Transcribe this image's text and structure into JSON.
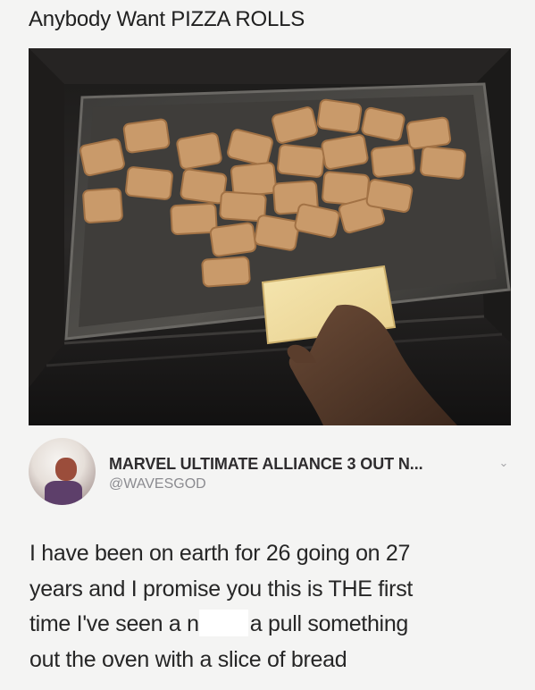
{
  "post": {
    "title": "Anybody Want PIZZA ROLLS"
  },
  "photo": {
    "description_icon": "pizza-rolls-on-tray-photo"
  },
  "tweet": {
    "display_name": "MARVEL ULTIMATE ALLIANCE 3 OUT N...",
    "handle": "@WAVESGOD",
    "menu_icon": "chevron-down-icon",
    "text_lines": {
      "line1": "I have been on earth for 26 going on 27",
      "line2": "years and I promise you this is THE first",
      "line3_before": "time I've seen a n",
      "line3_after": "a pull something",
      "line4": "out the oven with a slice of bread"
    }
  },
  "colors": {
    "background": "#f4f4f3",
    "name_text": "#2e2c2e",
    "handle_text": "#8b8b90",
    "body_text": "#262626"
  }
}
